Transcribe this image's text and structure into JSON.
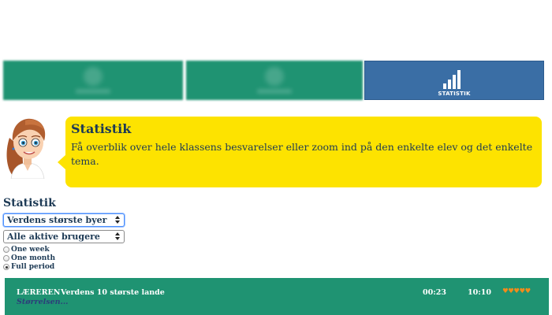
{
  "tabs": {
    "items": [
      {
        "label": "",
        "icon": "home-icon",
        "blurred": true
      },
      {
        "label": "",
        "icon": "globe-icon",
        "blurred": true
      },
      {
        "label": "STATISTIK",
        "icon": "bar-chart-icon",
        "active": true
      }
    ],
    "colors": {
      "inactive": "#1f9372",
      "active": "#3a6ea5"
    }
  },
  "guide": {
    "title": "Statistik",
    "text": "Få overblik over hele klassens besvarelser eller zoom ind på den enkelte elev og det enkelte tema.",
    "bubble_color": "#fde300"
  },
  "statistics": {
    "title": "Statistik",
    "topic_select": {
      "value": "Verdens største byer"
    },
    "user_select": {
      "value": "Alle aktive brugere"
    },
    "period_options": [
      {
        "label": "One week",
        "checked": false
      },
      {
        "label": "One month",
        "checked": false
      },
      {
        "label": "Full period",
        "checked": true
      }
    ]
  },
  "results": [
    {
      "role": "LÆREREN",
      "name": "Verdens 10 største lande",
      "subtitle": "Størrelsen...",
      "time1": "00:23",
      "time2": "10:10",
      "hearts": "♥♥♥♥♥",
      "hearts_color": "#f28c1b"
    }
  ]
}
